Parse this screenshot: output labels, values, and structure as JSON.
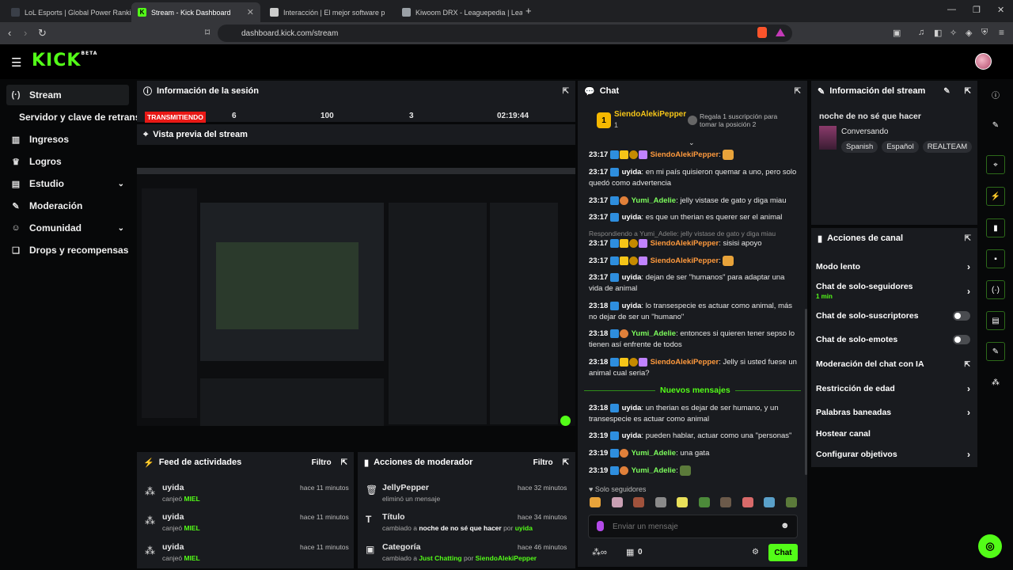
{
  "browser": {
    "tabs": [
      {
        "label": "LoL Esports | Global Power Rankings",
        "active": false
      },
      {
        "label": "Stream - Kick Dashboard",
        "active": true
      },
      {
        "label": "Interacción | El mejor software p",
        "active": false
      },
      {
        "label": "Kiwoom DRX - Leaguepedia | League",
        "active": false
      }
    ],
    "url": "dashboard.kick.com/stream"
  },
  "header": {
    "logo": "KICK",
    "logo_sup": "BETA"
  },
  "sidebar": {
    "items": [
      {
        "label": "Stream",
        "icon": "broadcast-icon"
      },
      {
        "label": "Servidor y clave de retransm",
        "icon": ""
      },
      {
        "label": "Ingresos",
        "icon": "chart-icon"
      },
      {
        "label": "Logros",
        "icon": "trophy-icon"
      },
      {
        "label": "Estudio",
        "icon": "studio-icon"
      },
      {
        "label": "Moderación",
        "icon": "wrench-icon"
      },
      {
        "label": "Comunidad",
        "icon": "community-icon"
      },
      {
        "label": "Drops y recompensas",
        "icon": "gift-icon"
      }
    ]
  },
  "session": {
    "title": "Información de la sesión",
    "status": "TRANSMITIENDO",
    "stats": [
      "6",
      "100",
      "3",
      "02:19:44"
    ]
  },
  "preview": {
    "title": "Vista previa del stream"
  },
  "feed": {
    "title": "Feed de actividades",
    "filter": "Filtro",
    "rows": [
      {
        "user": "uyida",
        "action": "canjeó",
        "item": "MIEL",
        "time": "hace 11 minutos"
      },
      {
        "user": "uyida",
        "action": "canjeó",
        "item": "MIEL",
        "time": "hace 11 minutos"
      },
      {
        "user": "uyida",
        "action": "canjeó",
        "item": "MIEL",
        "time": "hace 11 minutos"
      }
    ]
  },
  "modactions": {
    "title": "Acciones de moderador",
    "filter": "Filtro",
    "rows": [
      {
        "title": "JellyPepper",
        "desc_pre": "eliminó un mensaje",
        "bold": "",
        "desc_mid": "",
        "by": "",
        "time": "hace 32 minutos"
      },
      {
        "title": "Título",
        "desc_pre": "cambiado a ",
        "bold": "noche de no sé que hacer",
        "desc_mid": " por ",
        "by": "uyida",
        "time": "hace 34 minutos"
      },
      {
        "title": "Categoría",
        "desc_pre": "cambiado a ",
        "bold": "Just Chatting",
        "desc_mid": " por ",
        "by": "SiendoAlekiPepper",
        "time": "hace 46 minutos"
      }
    ]
  },
  "chat": {
    "title": "Chat",
    "pinned": {
      "user": "SiendoAlekiPepper",
      "rank": "1",
      "count": "1",
      "note": "Regala 1 suscripción para tomar la posición 2"
    },
    "messages": [
      {
        "time": "23:17",
        "user": "SiendoAlekiPepper",
        "color": "#ff9a3d",
        "text": ""
      },
      {
        "time": "23:17",
        "user": "uyida",
        "color": "#ffffff",
        "text": "en mi país quisieron quemar a uno, pero solo quedó como advertencia"
      },
      {
        "time": "23:17",
        "user": "Yumi_Adelie",
        "color": "#7cfc5c",
        "text": "jelly vistase de gato y diga miau"
      },
      {
        "time": "23:17",
        "user": "uyida",
        "color": "#ffffff",
        "text": "es que un therian es querer ser el animal"
      },
      {
        "time": "23:17",
        "user": "SiendoAlekiPepper",
        "color": "#ff9a3d",
        "text": "sisisi apoyo"
      },
      {
        "time": "23:17",
        "user": "SiendoAlekiPepper",
        "color": "#ff9a3d",
        "text": ""
      },
      {
        "time": "23:17",
        "user": "uyida",
        "color": "#ffffff",
        "text": "dejan de ser \"humanos\" para adaptar una vida de animal"
      },
      {
        "time": "23:18",
        "user": "uyida",
        "color": "#ffffff",
        "text": "lo transespecie es actuar como animal, más no dejar de ser un \"humano\""
      },
      {
        "time": "23:18",
        "user": "Yumi_Adelie",
        "color": "#7cfc5c",
        "text": "entonces si quieren tener sepso lo tienen así enfrente de todos"
      },
      {
        "time": "23:18",
        "user": "SiendoAlekiPepper",
        "color": "#ff9a3d",
        "text": "Jelly si usted fuese un animal cual seria?"
      },
      {
        "time": "23:18",
        "user": "uyida",
        "color": "#ffffff",
        "text": "un therian es dejar de ser humano, y un transespecie es actuar como animal"
      },
      {
        "time": "23:19",
        "user": "uyida",
        "color": "#ffffff",
        "text": "pueden hablar, actuar como una \"personas\""
      },
      {
        "time": "23:19",
        "user": "Yumi_Adelie",
        "color": "#7cfc5c",
        "text": "una gata"
      },
      {
        "time": "23:19",
        "user": "Yumi_Adelie",
        "color": "#7cfc5c",
        "text": ""
      }
    ],
    "reply_note": "Respondiendo a Yumi_Adelie: jelly vistase de gato y diga miau",
    "new_messages": "Nuevos mensajes",
    "followers_only": "Solo seguidores",
    "input_placeholder": "Enviar un mensaje",
    "footer_count": "0",
    "send": "Chat"
  },
  "streaminfo": {
    "title": "Información del stream",
    "stream_title": "noche de no sé que hacer",
    "category": "Conversando",
    "tags": [
      "Spanish",
      "Español",
      "REALTEAM"
    ]
  },
  "channel": {
    "title": "Acciones de canal",
    "items": [
      {
        "label": "Modo lento",
        "sub": "",
        "control": "chevron"
      },
      {
        "label": "Chat de solo-seguidores",
        "sub": "1 min",
        "control": "chevron"
      },
      {
        "label": "Chat de solo-suscriptores",
        "sub": "",
        "control": "toggle"
      },
      {
        "label": "Chat de solo-emotes",
        "sub": "",
        "control": "toggle"
      },
      {
        "label": "Moderación del chat con IA",
        "sub": "",
        "control": "external"
      },
      {
        "label": "Restricción de edad",
        "sub": "",
        "control": "chevron"
      },
      {
        "label": "Palabras baneadas",
        "sub": "",
        "control": "chevron"
      },
      {
        "label": "Hostear canal",
        "sub": "",
        "control": "none"
      },
      {
        "label": "Configurar objetivos",
        "sub": "",
        "control": "chevron"
      }
    ]
  },
  "colors": {
    "accent": "#53fc18",
    "live": "#e91916",
    "panel": "#191b1f"
  }
}
